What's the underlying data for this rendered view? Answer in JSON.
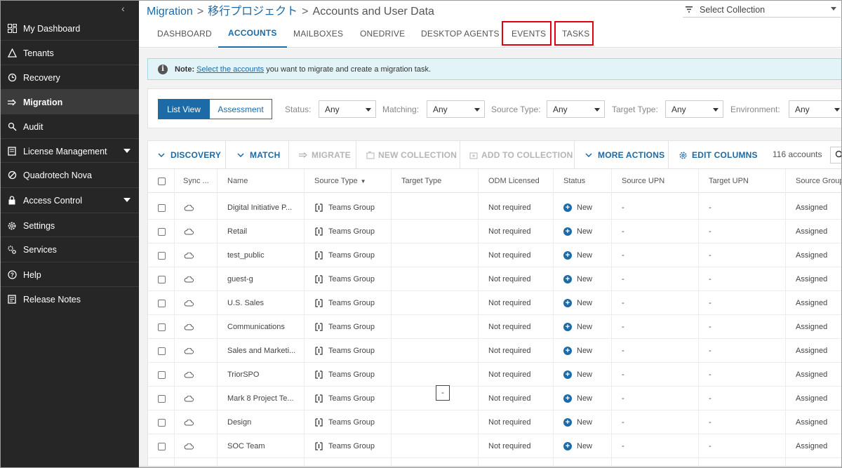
{
  "sidebar": {
    "collapse_glyph": "‹",
    "items": [
      {
        "label": "My Dashboard",
        "icon": "dashboard-icon",
        "active": false,
        "submenu": false
      },
      {
        "label": "Tenants",
        "icon": "tenants-icon",
        "active": false,
        "submenu": false
      },
      {
        "label": "Recovery",
        "icon": "recovery-icon",
        "active": false,
        "submenu": false
      },
      {
        "label": "Migration",
        "icon": "migration-icon",
        "active": true,
        "submenu": false
      },
      {
        "label": "Audit",
        "icon": "audit-icon",
        "active": false,
        "submenu": false
      },
      {
        "label": "License Management",
        "icon": "license-icon",
        "active": false,
        "submenu": true
      },
      {
        "label": "Quadrotech Nova",
        "icon": "nova-icon",
        "active": false,
        "submenu": false
      },
      {
        "label": "Access Control",
        "icon": "lock-icon",
        "active": false,
        "submenu": true
      },
      {
        "label": "Settings",
        "icon": "gear-icon",
        "active": false,
        "submenu": false
      },
      {
        "label": "Services",
        "icon": "services-icon",
        "active": false,
        "submenu": false
      },
      {
        "label": "Help",
        "icon": "help-icon",
        "active": false,
        "submenu": false
      },
      {
        "label": "Release Notes",
        "icon": "notes-icon",
        "active": false,
        "submenu": false
      }
    ]
  },
  "breadcrumb": {
    "part1": "Migration",
    "part2": "移行プロジェクト",
    "part3": "Accounts and User Data",
    "separator": ">"
  },
  "collection": {
    "label": "Select Collection"
  },
  "tabs": [
    "DASHBOARD",
    "ACCOUNTS",
    "MAILBOXES",
    "ONEDRIVE",
    "DESKTOP AGENTS",
    "EVENTS",
    "TASKS"
  ],
  "active_tab": "ACCOUNTS",
  "note": {
    "prefix": "Note:",
    "link": "Select the accounts",
    "suffix": " you want to migrate and create a migration task."
  },
  "view_toggle": {
    "list": "List View",
    "assessment": "Assessment"
  },
  "filters": [
    {
      "label": "Status:",
      "value": "Any"
    },
    {
      "label": "Matching:",
      "value": "Any"
    },
    {
      "label": "Source Type:",
      "value": "Any"
    },
    {
      "label": "Target Type:",
      "value": "Any"
    },
    {
      "label": "Environment:",
      "value": "Any"
    }
  ],
  "toolbar": {
    "discovery": "DISCOVERY",
    "match": "MATCH",
    "migrate": "MIGRATE",
    "new_collection": "NEW COLLECTION",
    "add_to_collection": "ADD TO COLLECTION",
    "more_actions": "MORE ACTIONS",
    "edit_columns": "EDIT COLUMNS",
    "count": "116 accounts"
  },
  "columns": [
    "Sync ...",
    "Name",
    "Source Type",
    "Target Type",
    "ODM Licensed",
    "Status",
    "Source UPN",
    "Target UPN",
    "Source Group"
  ],
  "rows": [
    {
      "name": "Digital Initiative P...",
      "source_type": "Teams Group",
      "target_type": "",
      "odm": "Not required",
      "status": "New",
      "source_upn": "-",
      "target_upn": "-",
      "source_group": "Assigned"
    },
    {
      "name": "Retail",
      "source_type": "Teams Group",
      "target_type": "",
      "odm": "Not required",
      "status": "New",
      "source_upn": "-",
      "target_upn": "-",
      "source_group": "Assigned"
    },
    {
      "name": "test_public",
      "source_type": "Teams Group",
      "target_type": "",
      "odm": "Not required",
      "status": "New",
      "source_upn": "-",
      "target_upn": "-",
      "source_group": "Assigned"
    },
    {
      "name": "guest-g",
      "source_type": "Teams Group",
      "target_type": "",
      "odm": "Not required",
      "status": "New",
      "source_upn": "-",
      "target_upn": "-",
      "source_group": "Assigned"
    },
    {
      "name": "U.S. Sales",
      "source_type": "Teams Group",
      "target_type": "",
      "odm": "Not required",
      "status": "New",
      "source_upn": "-",
      "target_upn": "-",
      "source_group": "Assigned"
    },
    {
      "name": "Communications",
      "source_type": "Teams Group",
      "target_type": "",
      "odm": "Not required",
      "status": "New",
      "source_upn": "-",
      "target_upn": "-",
      "source_group": "Assigned"
    },
    {
      "name": "Sales and Marketi...",
      "source_type": "Teams Group",
      "target_type": "",
      "odm": "Not required",
      "status": "New",
      "source_upn": "-",
      "target_upn": "-",
      "source_group": "Assigned"
    },
    {
      "name": "TriorSPO",
      "source_type": "Teams Group",
      "target_type": "",
      "odm": "Not required",
      "status": "New",
      "source_upn": "-",
      "target_upn": "-",
      "source_group": "Assigned"
    },
    {
      "name": "Mark 8 Project Te...",
      "source_type": "Teams Group",
      "target_type": "",
      "odm": "Not required",
      "status": "New",
      "source_upn": "-",
      "target_upn": "-",
      "source_group": "Assigned"
    },
    {
      "name": "Design",
      "source_type": "Teams Group",
      "target_type": "",
      "odm": "Not required",
      "status": "New",
      "source_upn": "-",
      "target_upn": "-",
      "source_group": "Assigned"
    },
    {
      "name": "SOC Team",
      "source_type": "Teams Group",
      "target_type": "",
      "odm": "Not required",
      "status": "New",
      "source_upn": "-",
      "target_upn": "-",
      "source_group": "Assigned"
    }
  ],
  "tooltip_text": "-",
  "colors": {
    "sidebar_bg": "#262626",
    "accent": "#1c6aa6",
    "highlight": "#e0000f",
    "note_bg": "#e2f4f8"
  }
}
